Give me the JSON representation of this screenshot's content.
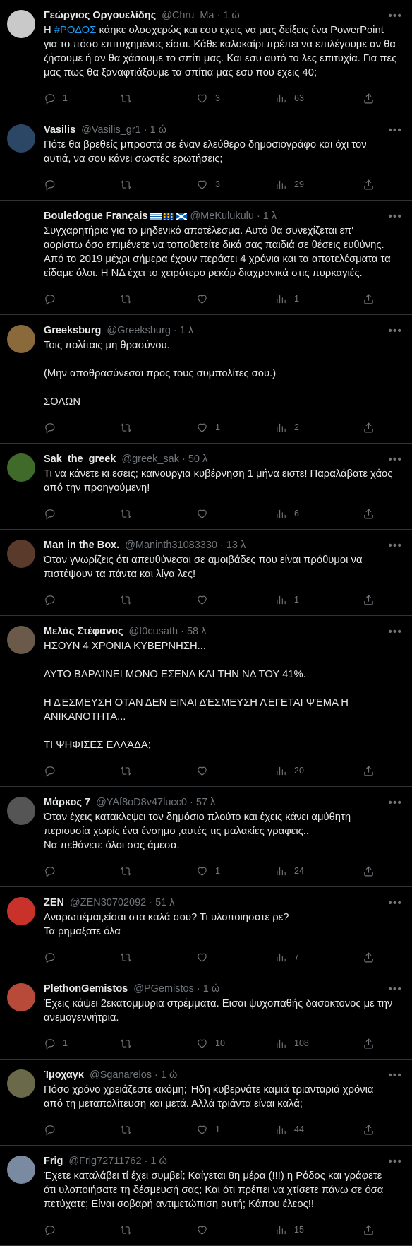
{
  "tweets": [
    {
      "name": "Γεώργιος Οργουελίδης",
      "handle": "@Chru_Ma",
      "time": "1 ώ",
      "text_pre": "Η ",
      "hashtag": "#ΡΟΔΟΣ",
      "text": " κάηκε ολοσχερώς και εσυ εχεις να μας δείξεις ένα PowerPoint\nγια το πόσο επιτυχημένος είσαι. Κάθε καλοκαίρι πρέπει να επιλέγουμε αν θα\nζήσουμε ή αν θα χάσουμε το σπίτι μας. Και εσυ αυτό το λες επιτυχία. Για πες\nμας πως θα ξαναφτιάξουμε τα σπίτια μας εσυ που εχεις 40;",
      "replies": "1",
      "retweets": "",
      "likes": "3",
      "views": "63",
      "avatar": "#c9c9c9"
    },
    {
      "name": "Vasilis",
      "handle": "@Vasilis_gr1",
      "time": "1 ώ",
      "text": "Πότε θα βρεθείς μπροστά σε έναν ελεύθερο δημοσιογράφο και όχι τον\nαυτιά, να σου κάνει σωστές ερωτήσεις;",
      "replies": "",
      "retweets": "",
      "likes": "3",
      "views": "29",
      "avatar": "#2c4766"
    },
    {
      "name": "Bouledogue Français",
      "handle": "@MeKulukulu",
      "time": "1 λ",
      "text": "Συγχαρητήρια για το μηδενικό αποτέλεσμα. Αυτό θα συνεχίζεται επ'\nαορίστω όσο επιμένετε να τοποθετείτε δικά σας παιδιά σε θέσεις ευθύνης.\nΑπό το 2019 μέχρι σήμερα έχουν περάσει 4 χρόνια και τα αποτελέσματα τα\nείδαμε όλοι. Η ΝΔ έχει το χειρότερο ρεκόρ διαχρονικά στις πυρκαγιές.",
      "replies": "",
      "retweets": "",
      "likes": "",
      "views": "1",
      "avatar": "#000000"
    },
    {
      "name": "Greeksburg",
      "handle": "@Greeksburg",
      "time": "1 λ",
      "text": "Τοις πολίταις μη θρασύνου.\n\n(Μην αποθρασύνεσαι προς τους συμπολίτες σου.)\n\nΣΟΛΩΝ",
      "replies": "",
      "retweets": "",
      "likes": "1",
      "views": "2",
      "avatar": "#8a6a3a"
    },
    {
      "name": "Sak_the_greek",
      "handle": "@greek_sak",
      "time": "50 λ",
      "text": "Τι να κάνετε κι εσεις; καινουργια κυβέρνηση 1 μήνα ειστε! Παραλάβατε χάος\nαπό την προηγούμενη!",
      "replies": "",
      "retweets": "",
      "likes": "",
      "views": "6",
      "avatar": "#3f6a2a"
    },
    {
      "name": "Man in the Box.",
      "handle": "@Maninth31083330",
      "time": "13 λ",
      "text": "Όταν γνωρίζεις ότι απευθύνεσαι σε αμοιβάδες που είναι πρόθυμοι να\nπιστέψουν τα πάντα και λίγα λες!",
      "replies": "",
      "retweets": "",
      "likes": "",
      "views": "1",
      "avatar": "#5a3a2a"
    },
    {
      "name": "Μελάς Στέφανος",
      "handle": "@f0cusath",
      "time": "58 λ",
      "text": "ΗΣΟΥΝ 4 ΧΡΟΝΙΑ ΚΥΒΕΡΝΗΣΗ...\n\nΑΥΤΟ ΒΑΡΑΊΝΕΙ ΜΟΝΟ ΕΣΕΝΑ ΚΑΙ ΤΗΝ ΝΔ ΤΟΥ 41%.\n\nΗ ΔΈΣΜΕΥΣΗ ΟΤΑΝ ΔΕΝ ΕΙΝΑΙ ΔΈΣΜΕΥΣΗ ΛΈΓΕΤΑΙ ΨΈΜΑ Η\nΑΝΙΚΑΝΌΤΗΤΑ...\n\nΤΙ ΨΗΦΙΣΕΣ ΕΛΛΆΔΑ;",
      "replies": "",
      "retweets": "",
      "likes": "",
      "views": "20",
      "avatar": "#6b5a4a"
    },
    {
      "name": "Μάρκος 7",
      "handle": "@YAf8oD8v47lucc0",
      "time": "57 λ",
      "text": "Όταν έχεις κατακλεψει τον δημόσιο πλούτο και έχεις κάνει αμύθητη\nπεριουσία χωρίς ένα ένσημο ,αυτές τις μαλακίες γραφεις..\nΝα πεθάνετε όλοι σας άμεσα.",
      "replies": "",
      "retweets": "",
      "likes": "1",
      "views": "24",
      "avatar": "#555555"
    },
    {
      "name": "ZEN",
      "handle": "@ZEN30702092",
      "time": "51 λ",
      "text": "Αναρωτιέμαι,είσαι στα καλά σου? Τι υλοποιησατε ρε?\nΤα ρημαξατε όλα",
      "replies": "",
      "retweets": "",
      "likes": "",
      "views": "7",
      "avatar": "#c8322a"
    },
    {
      "name": "PlethonGemistos",
      "handle": "@PGemistos",
      "time": "1 ώ",
      "text": "Έχεις κάψει 2εκατομμυρια στρέμματα. Εισαι ψυχοπαθής δασοκτονος με την\nανεμογεννήτρια.",
      "replies": "1",
      "retweets": "",
      "likes": "10",
      "views": "108",
      "avatar": "#b84a3a"
    },
    {
      "name": "Ίμοχαγκ",
      "handle": "@Sganarelos",
      "time": "1 ώ",
      "text": "Πόσο χρόνο χρειάζεστε ακόμη; Ήδη κυβερνάτε καμιά τριανταριά χρόνια\nαπό τη μεταπολίτευση και μετά. Αλλά τριάντα είναι καλά;",
      "replies": "",
      "retweets": "",
      "likes": "1",
      "views": "44",
      "avatar": "#6a6a4a"
    },
    {
      "name": "Frig",
      "handle": "@Frig72711762",
      "time": "1 ώ",
      "text": "Έχετε καταλάβει τί έχει συμβεί; Καίγεται 8η μέρα (!!!) η Ρόδος και γράφετε\nότι υλοποιήσατε τη δέσμευσή σας; Και ότι πρέπει να χτίσετε πάνω σε όσα\nπετύχατε; Είναι σοβαρή αντιμετώπιση αυτή; Κάπου έλεος!!",
      "replies": "",
      "retweets": "",
      "likes": "",
      "views": "15",
      "avatar": "#7a8aa0"
    }
  ],
  "flags": [
    "greece-flag",
    "eu-flag",
    "scotland-flag"
  ],
  "colors": {
    "bg": "#000000",
    "text": "#e7e9ea",
    "muted": "#71767b",
    "accent": "#1d9bf0",
    "divider": "#2f3336"
  },
  "icons": {
    "reply": "reply-icon",
    "retweet": "retweet-icon",
    "like": "like-icon",
    "views": "views-icon",
    "share": "share-icon",
    "more": "more-icon"
  }
}
